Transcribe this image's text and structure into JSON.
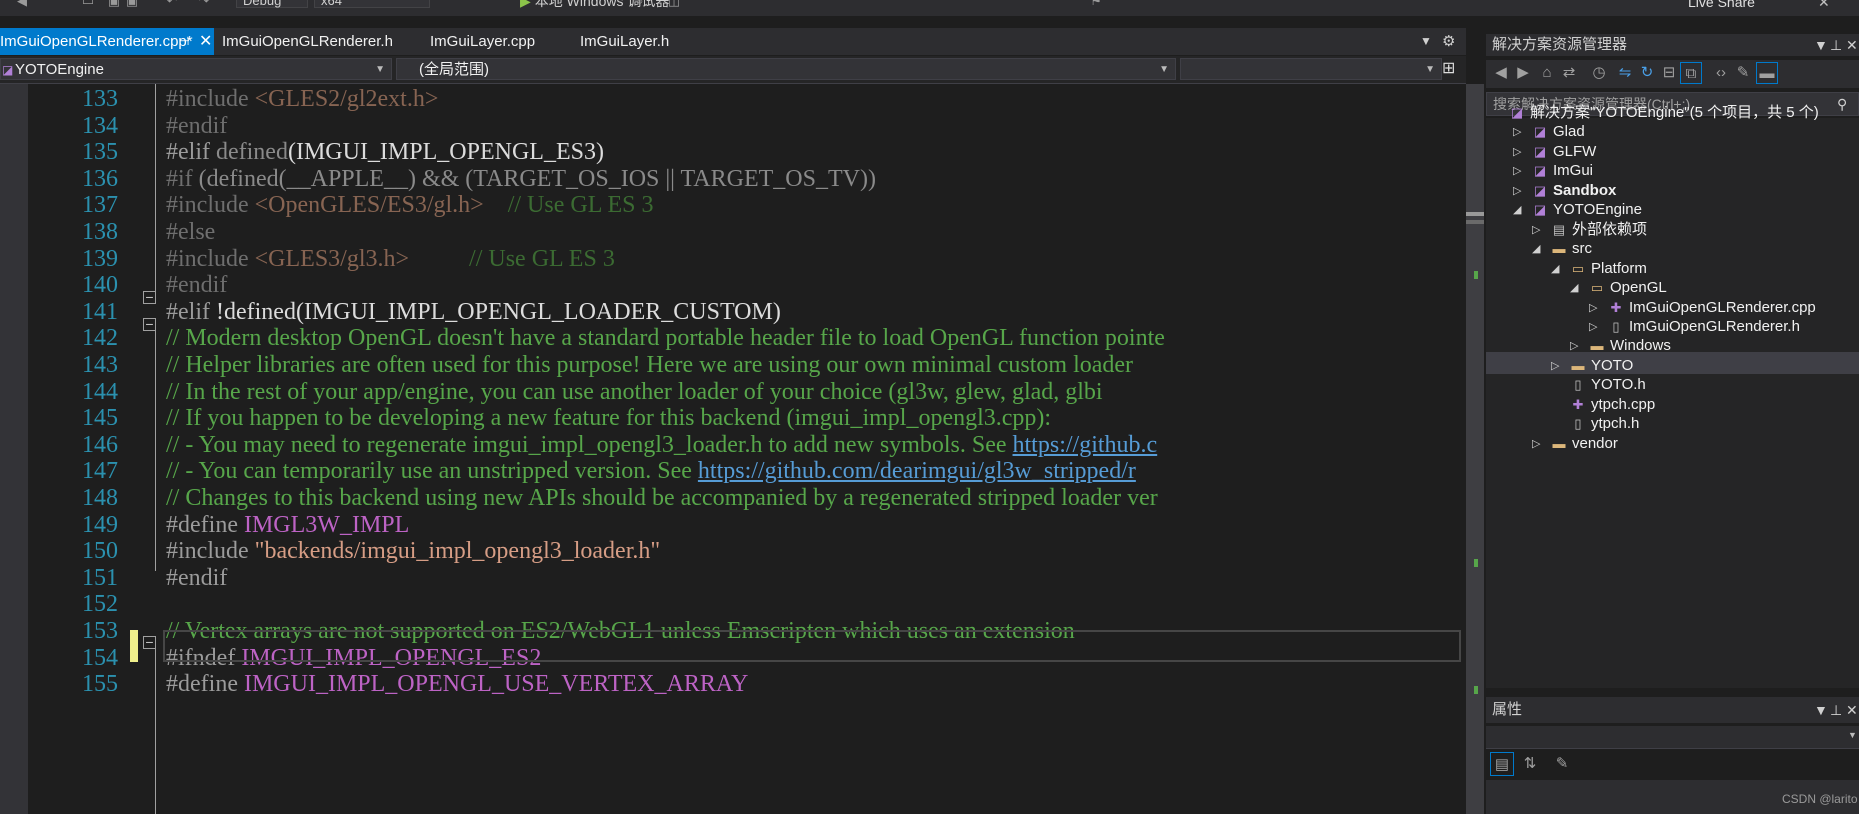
{
  "toolbar": {
    "config": "Debug",
    "platform": "x64",
    "run_label": "本地 Windows 调试器",
    "live_share": "Live Share"
  },
  "tabs": [
    {
      "label": "ImGuiOpenGLRenderer.cpp*",
      "active": true
    },
    {
      "label": "ImGuiOpenGLRenderer.h",
      "active": false
    },
    {
      "label": "ImGuiLayer.cpp",
      "active": false
    },
    {
      "label": "ImGuiLayer.h",
      "active": false
    }
  ],
  "nav": {
    "project": "YOTOEngine",
    "scope": "(全局范围)"
  },
  "editor": {
    "lines": [
      {
        "n": "133",
        "parts": [
          [
            "ppd",
            "#include "
          ],
          [
            "strd",
            "<GLES2/gl2ext.h>"
          ]
        ]
      },
      {
        "n": "134",
        "parts": [
          [
            "ppd",
            "#endif"
          ]
        ]
      },
      {
        "n": "135",
        "parts": [
          [
            "pp",
            "#elif "
          ],
          [
            "txtd",
            "defined"
          ],
          [
            "txt",
            "(IMGUI_IMPL_OPENGL_ES3)"
          ]
        ]
      },
      {
        "n": "136",
        "parts": [
          [
            "ppd",
            "#if "
          ],
          [
            "txtd",
            "(defined(__APPLE__) && (TARGET_OS_IOS || TARGET_OS_TV))"
          ]
        ]
      },
      {
        "n": "137",
        "parts": [
          [
            "ppd",
            "#include "
          ],
          [
            "strd",
            "<OpenGLES/ES3/gl.h>"
          ],
          [
            "cmd",
            "    // Use GL ES 3"
          ]
        ]
      },
      {
        "n": "138",
        "parts": [
          [
            "ppd",
            "#else"
          ]
        ]
      },
      {
        "n": "139",
        "parts": [
          [
            "ppd",
            "#include "
          ],
          [
            "strd",
            "<GLES3/gl3.h>"
          ],
          [
            "cmd",
            "          // Use GL ES 3"
          ]
        ]
      },
      {
        "n": "140",
        "parts": [
          [
            "ppd",
            "#endif"
          ]
        ]
      },
      {
        "n": "141",
        "parts": [
          [
            "pp",
            "#elif "
          ],
          [
            "txt",
            "!defined(IMGUI_IMPL_OPENGL_LOADER_CUSTOM)"
          ]
        ]
      },
      {
        "n": "142",
        "parts": [
          [
            "cm",
            "// Modern desktop OpenGL doesn't have a standard portable header file to load OpenGL function pointe"
          ]
        ]
      },
      {
        "n": "143",
        "parts": [
          [
            "cm",
            "// Helper libraries are often used for this purpose! Here we are using our own minimal custom loader"
          ]
        ]
      },
      {
        "n": "144",
        "parts": [
          [
            "cm",
            "// In the rest of your app/engine, you can use another loader of your choice (gl3w, glew, glad, glbi"
          ]
        ]
      },
      {
        "n": "145",
        "parts": [
          [
            "cm",
            "// If you happen to be developing a new feature for this backend (imgui_impl_opengl3.cpp):"
          ]
        ]
      },
      {
        "n": "146",
        "parts": [
          [
            "cm",
            "// - You may need to regenerate imgui_impl_opengl3_loader.h to add new symbols. See "
          ],
          [
            "lnk",
            "https://github.c"
          ]
        ]
      },
      {
        "n": "147",
        "parts": [
          [
            "cm",
            "// - You can temporarily use an unstripped version. See "
          ],
          [
            "lnk",
            "https://github.com/dearimgui/gl3w_stripped/r"
          ]
        ]
      },
      {
        "n": "148",
        "parts": [
          [
            "cm",
            "// Changes to this backend using new APIs should be accompanied by a regenerated stripped loader ver"
          ]
        ]
      },
      {
        "n": "149",
        "parts": [
          [
            "pp",
            "#define "
          ],
          [
            "mac",
            "IMGL3W_IMPL"
          ]
        ]
      },
      {
        "n": "150",
        "parts": [
          [
            "pp",
            "#include "
          ],
          [
            "str",
            "\"backends/imgui_impl_opengl3_loader.h\""
          ]
        ]
      },
      {
        "n": "151",
        "parts": [
          [
            "pp",
            "#endif"
          ]
        ]
      },
      {
        "n": "152",
        "parts": []
      },
      {
        "n": "153",
        "parts": [
          [
            "cm",
            "// Vertex arrays are not supported on ES2/WebGL1 unless Emscripten which uses an extension"
          ]
        ]
      },
      {
        "n": "154",
        "parts": [
          [
            "pp",
            "#ifndef "
          ],
          [
            "mac",
            "IMGUI_IMPL_OPENGL_ES2"
          ]
        ]
      },
      {
        "n": "155",
        "parts": [
          [
            "pp",
            "#define "
          ],
          [
            "mac",
            "IMGUI_IMPL_OPENGL_USE_VERTEX_ARRAY"
          ]
        ]
      }
    ]
  },
  "solution_explorer": {
    "title": "解决方案资源管理器",
    "search_placeholder": "搜索解决方案资源管理器(Ctrl+;)",
    "tree": [
      {
        "label": "解决方案\"YOTOEngine\"(5 个项目，共 5 个)",
        "depth": 0,
        "icon": "solution-icon",
        "expander": ""
      },
      {
        "label": "Glad",
        "depth": 1,
        "icon": "project-icon",
        "expander": "collapsed"
      },
      {
        "label": "GLFW",
        "depth": 1,
        "icon": "project-icon",
        "expander": "collapsed"
      },
      {
        "label": "ImGui",
        "depth": 1,
        "icon": "project-icon",
        "expander": "collapsed"
      },
      {
        "label": "Sandbox",
        "depth": 1,
        "icon": "project-icon",
        "expander": "collapsed",
        "bold": true
      },
      {
        "label": "YOTOEngine",
        "depth": 1,
        "icon": "project-icon",
        "expander": "expanded"
      },
      {
        "label": "外部依赖项",
        "depth": 2,
        "icon": "external-deps-icon",
        "expander": "collapsed"
      },
      {
        "label": "src",
        "depth": 2,
        "icon": "folder-icon",
        "expander": "expanded"
      },
      {
        "label": "Platform",
        "depth": 3,
        "icon": "folder-open-icon",
        "expander": "expanded"
      },
      {
        "label": "OpenGL",
        "depth": 4,
        "icon": "folder-open-icon",
        "expander": "expanded"
      },
      {
        "label": "ImGuiOpenGLRenderer.cpp",
        "depth": 5,
        "icon": "cpp-file-icon",
        "expander": "collapsed",
        "selected": true
      },
      {
        "label": "ImGuiOpenGLRenderer.h",
        "depth": 5,
        "icon": "header-file-icon",
        "expander": "collapsed"
      },
      {
        "label": "Windows",
        "depth": 4,
        "icon": "folder-icon",
        "expander": "collapsed"
      },
      {
        "label": "YOTO",
        "depth": 3,
        "icon": "folder-icon",
        "expander": "collapsed"
      },
      {
        "label": "YOTO.h",
        "depth": 3,
        "icon": "header-file-icon",
        "expander": ""
      },
      {
        "label": "ytpch.cpp",
        "depth": 3,
        "icon": "cpp-file-icon",
        "expander": ""
      },
      {
        "label": "ytpch.h",
        "depth": 3,
        "icon": "header-file-icon",
        "expander": ""
      },
      {
        "label": "vendor",
        "depth": 2,
        "icon": "folder-icon",
        "expander": "collapsed"
      }
    ]
  },
  "properties": {
    "title": "属性"
  },
  "watermark": "CSDN @larito",
  "colors": {
    "accent": "#007acc",
    "line_number": "#2b91af",
    "comment": "#57a64a",
    "macro": "#bd63c5",
    "string": "#d69d85"
  }
}
